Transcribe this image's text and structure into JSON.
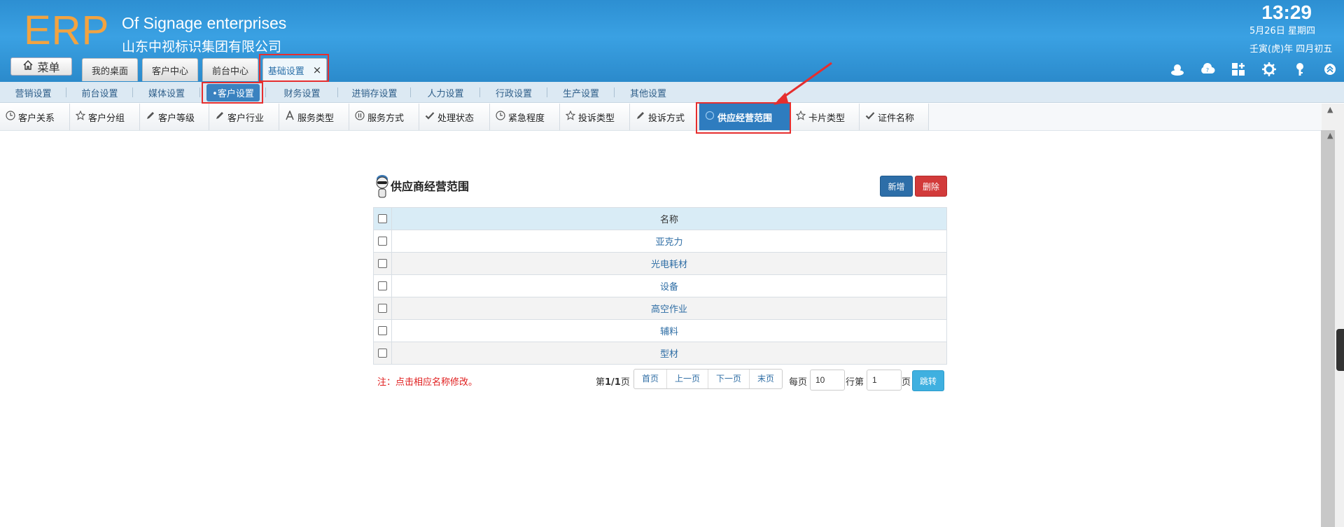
{
  "header": {
    "logo": "ERP",
    "company_en": "Of Signage enterprises",
    "company_cn": "山东中视标识集团有限公司",
    "time": "13:29",
    "date": "5月26日 星期四",
    "lunar_date": "壬寅(虎)年 四月初五",
    "menu_label": "菜单",
    "tabs": [
      {
        "label": "我的桌面"
      },
      {
        "label": "客户中心"
      },
      {
        "label": "前台中心"
      },
      {
        "label": "基础设置",
        "close": "×"
      }
    ],
    "icons": [
      "user-icon",
      "cloud-help-icon",
      "grid-add-icon",
      "gear-icon",
      "key-icon",
      "collapse-up-icon"
    ]
  },
  "menu2": {
    "items": [
      {
        "label": "营销设置"
      },
      {
        "label": "前台设置"
      },
      {
        "label": "媒体设置"
      },
      {
        "label": "•客户设置"
      },
      {
        "label": "财务设置"
      },
      {
        "label": "进销存设置"
      },
      {
        "label": "人力设置"
      },
      {
        "label": "行政设置"
      },
      {
        "label": "生产设置"
      },
      {
        "label": "其他设置"
      }
    ],
    "active_index": 3
  },
  "menu3": {
    "items": [
      {
        "label": "客户关系",
        "icon": "clock-icon"
      },
      {
        "label": "客户分组",
        "icon": "star-icon"
      },
      {
        "label": "客户等级",
        "icon": "pencil-icon"
      },
      {
        "label": "客户行业",
        "icon": "pencil-icon"
      },
      {
        "label": "服务类型",
        "icon": "letter-a-icon"
      },
      {
        "label": "服务方式",
        "icon": "pause-icon"
      },
      {
        "label": "处理状态",
        "icon": "check-icon"
      },
      {
        "label": "紧急程度",
        "icon": "clock-icon"
      },
      {
        "label": "投诉类型",
        "icon": "star-icon"
      },
      {
        "label": "投诉方式",
        "icon": "pencil-icon"
      },
      {
        "label": "供应经营范围",
        "icon": "circle-icon"
      },
      {
        "label": "卡片类型",
        "icon": "star-icon"
      },
      {
        "label": "证件名称",
        "icon": "check-icon"
      }
    ],
    "active_index": 10
  },
  "panel": {
    "title": "供应商经营范围",
    "add_label": "新增",
    "delete_label": "删除",
    "column_header": "名称",
    "rows": [
      {
        "name": "亚克力"
      },
      {
        "name": "光电耗材"
      },
      {
        "name": "设备"
      },
      {
        "name": "高空作业"
      },
      {
        "name": "辅料"
      },
      {
        "name": "型材"
      }
    ]
  },
  "footer": {
    "note": "注：点击相应名称修改。",
    "page_prefix": "第",
    "page_value": "1/1",
    "page_suffix": "页",
    "first": "首页",
    "prev": "上一页",
    "next": "下一页",
    "last": "末页",
    "per_page_label": "每页",
    "per_page_value": "10",
    "row_label": "行第",
    "page_input_value": "1",
    "page_label": "页",
    "go_label": "跳转"
  },
  "colors": {
    "header_blue": "#3aa1e3",
    "logo_orange": "#f2a340",
    "active_tab": "#2e7cbf",
    "highlight_red": "#e62e2e"
  }
}
